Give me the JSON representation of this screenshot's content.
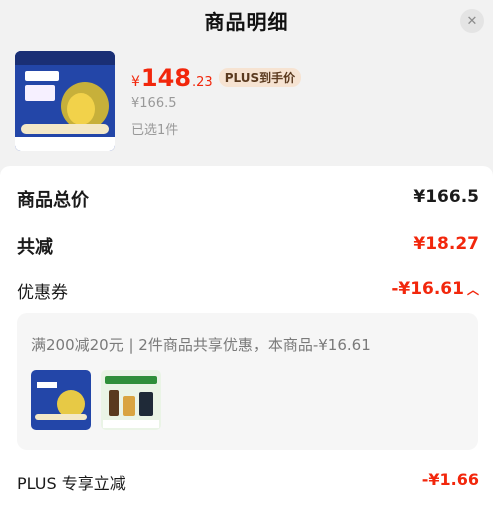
{
  "header": {
    "title": "商品明细"
  },
  "product": {
    "price_symbol": "¥",
    "price_int": "148",
    "price_dec": ".23",
    "plus_tag": "PLUS到手价",
    "original_price": "¥166.5",
    "selected": "已选1件"
  },
  "summary": {
    "total_label": "商品总价",
    "total_value": "¥166.5",
    "discount_label": "共减",
    "discount_value": "¥18.27",
    "coupon_label": "优惠券",
    "coupon_value": "-¥16.61",
    "coupon_desc": "满200减20元 | 2件商品共享优惠，本商品-¥16.61",
    "plus_label": "PLUS 专享立减",
    "plus_value": "-¥1.66"
  },
  "colors": {
    "red": "#f2270c",
    "plus_bg": "#f6e3d2"
  }
}
